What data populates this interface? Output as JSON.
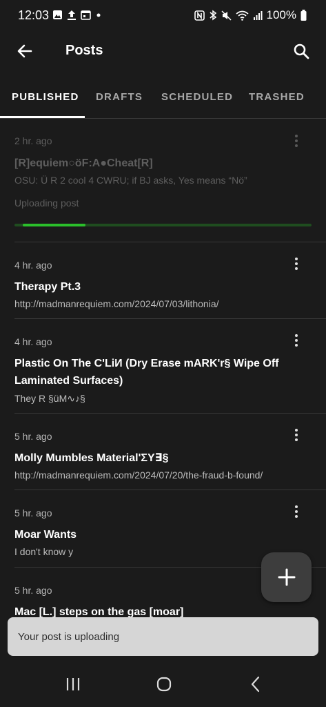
{
  "status_bar": {
    "time": "12:03",
    "battery_percent": "100%",
    "left_icons": [
      "image-icon",
      "upload-icon",
      "calendar-icon",
      "dot-icon"
    ],
    "right_icons": [
      "nfc-icon",
      "bluetooth-icon",
      "mute-icon",
      "wifi-icon",
      "signal-icon",
      "battery-icon"
    ]
  },
  "app_bar": {
    "title": "Posts",
    "back_icon": "back-arrow-icon",
    "search_icon": "search-icon"
  },
  "tabs": [
    {
      "label": "PUBLISHED",
      "active": true
    },
    {
      "label": "DRAFTS",
      "active": false
    },
    {
      "label": "SCHEDULED",
      "active": false
    },
    {
      "label": "TRASHED",
      "active": false
    }
  ],
  "posts": [
    {
      "time": "2 hr. ago",
      "title": "[R]equiem○öF:A●Cheat[R]",
      "subtitle": "OSU: Ü R 2 cool 4 CWRU; if BJ asks, Yes means “Nö”",
      "status": "Uploading post",
      "upload_progress": 0.21
    },
    {
      "time": "4 hr. ago",
      "title": "Therapy Pt.3",
      "subtitle": "http://madmanrequiem.com/2024/07/03/lithonia/"
    },
    {
      "time": "4 hr. ago",
      "title_line1": "Plastic On The C'LiИ (Dry Erase mARK'r§ Wipe Off",
      "title_line2": "Laminated Surfaces)",
      "subtitle": "They R §üM∿♪§"
    },
    {
      "time": "5 hr. ago",
      "title": "Molly Mumbles Material'ΣΥ∃§",
      "subtitle": "http://madmanrequiem.com/2024/07/20/the-fraud-b-found/"
    },
    {
      "time": "5 hr. ago",
      "title": "Moar Wants",
      "subtitle": "I don't know y"
    },
    {
      "time": "5 hr. ago",
      "title": "Mac [L.] steps on the gas [moar]"
    }
  ],
  "fab": {
    "icon": "plus-icon"
  },
  "snackbar": {
    "text": "Your post is uploading"
  },
  "nav_bar": {
    "icons": [
      "recent-apps-icon",
      "home-icon",
      "nav-back-icon"
    ]
  },
  "colors": {
    "background": "#1b1b1b",
    "progress": "#2bbf2b",
    "progress_track": "#1f4d1f",
    "snackbar": "#d6d6d6",
    "fab": "#3d3d3d"
  }
}
